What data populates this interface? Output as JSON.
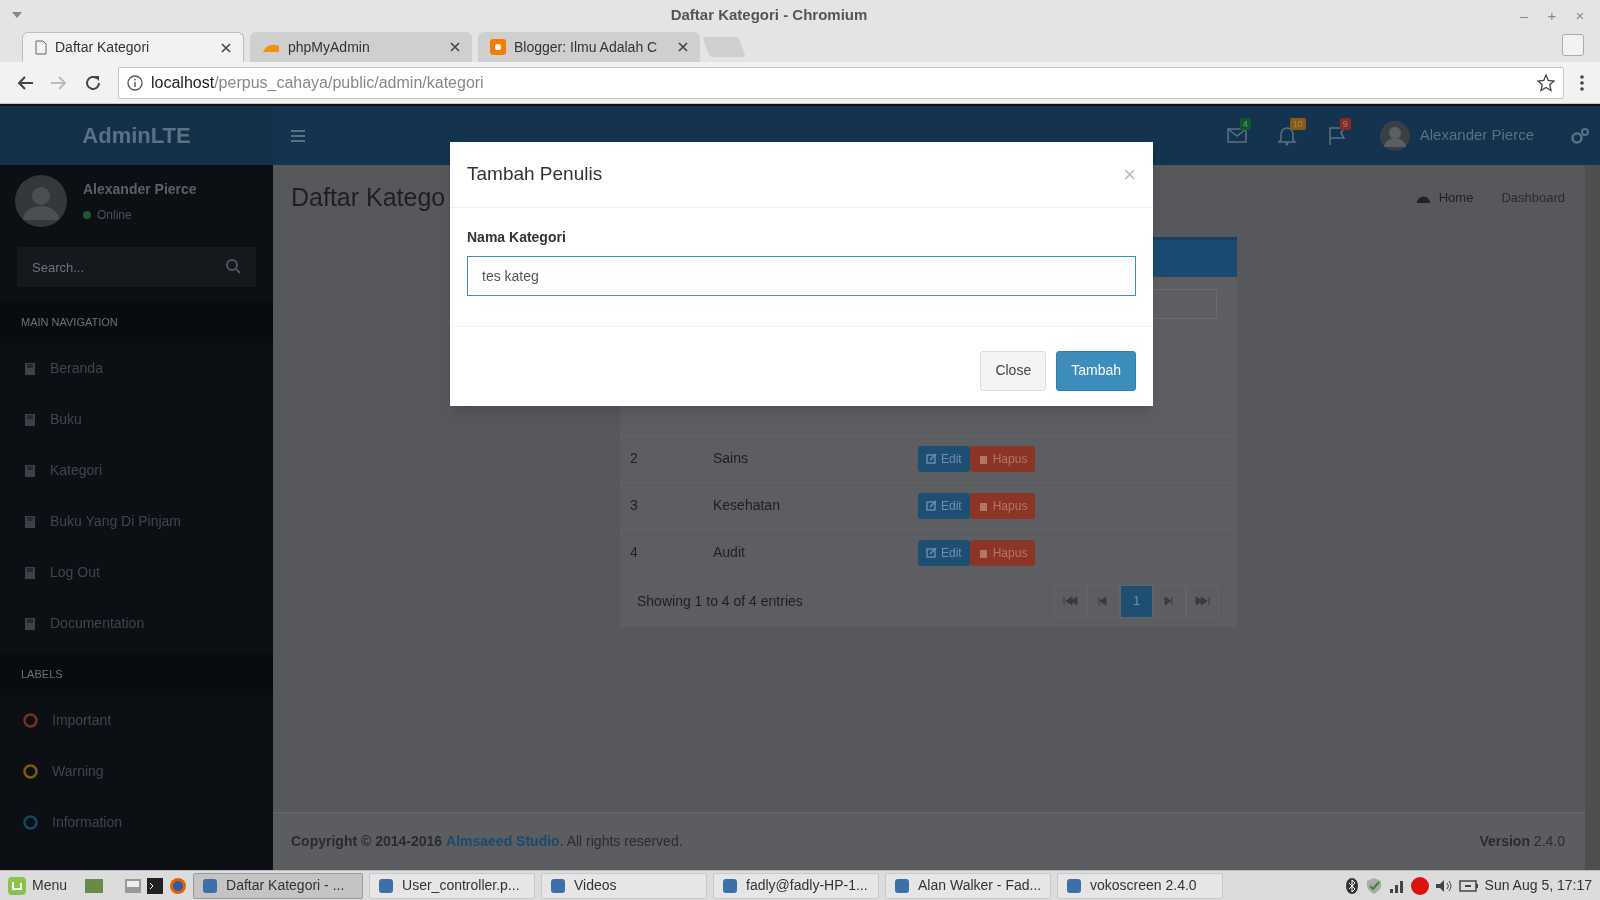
{
  "window": {
    "title": "Daftar Kategori - Chromium",
    "controls": [
      "–",
      "+",
      "×"
    ]
  },
  "browser_tabs": [
    {
      "label": "Daftar Kategori",
      "selected": true
    },
    {
      "label": "phpMyAdmin",
      "selected": false
    },
    {
      "label": "Blogger: Ilmu Adalah C",
      "selected": false
    }
  ],
  "address_bar": {
    "host": "localhost",
    "path": "/perpus_cahaya/public/admin/kategori"
  },
  "header": {
    "logo": "AdminLTE",
    "notifications": [
      {
        "kind": "mail",
        "count": "4",
        "color": "#0b5a2c"
      },
      {
        "kind": "bell",
        "count": "10",
        "color": "#8a5a10"
      },
      {
        "kind": "flag",
        "count": "9",
        "color": "#8a2a22"
      }
    ],
    "user": "Alexander Pierce"
  },
  "sidebar": {
    "user": "Alexander Pierce",
    "status": "Online",
    "search_placeholder": "Search...",
    "nav_header": "MAIN NAVIGATION",
    "items": [
      "Beranda",
      "Buku",
      "Kategori",
      "Buku Yang Di Pinjam",
      "Log Out",
      "Documentation"
    ],
    "labels_header": "LABELS",
    "labels": [
      {
        "label": "Important",
        "color": "#7a2e22"
      },
      {
        "label": "Warning",
        "color": "#7a5a10"
      },
      {
        "label": "Information",
        "color": "#0e4a66"
      }
    ]
  },
  "content": {
    "heading": "Daftar Katego",
    "breadcrumb": [
      "Home",
      "Dashboard"
    ],
    "rows": [
      {
        "no": "2",
        "name": "Sains",
        "actions": [
          "Edit",
          "Hapus"
        ]
      },
      {
        "no": "3",
        "name": "Kesehatan",
        "actions": [
          "Edit",
          "Hapus"
        ]
      },
      {
        "no": "4",
        "name": "Audit",
        "actions": [
          "Edit",
          "Hapus"
        ]
      }
    ],
    "info": "Showing 1 to 4 of 4 entries",
    "pages": [
      {
        "kind": "first",
        "selected": false
      },
      {
        "kind": "prev",
        "selected": false
      },
      {
        "kind": "page",
        "label": "1",
        "selected": true
      },
      {
        "kind": "next",
        "selected": false
      },
      {
        "kind": "last",
        "selected": false
      }
    ]
  },
  "footer": {
    "copyright": "**Copyright © 2014-2016**",
    "link": "Almsaeed Studio",
    "rest": ". All rights reserved.",
    "version": "**Version** 2.4.0"
  },
  "modal": {
    "title": "Tambah Penulis",
    "close": "×",
    "label": "Nama Kategori",
    "value": "tes kateg",
    "buttons": [
      {
        "kind": "default",
        "label": "Close"
      },
      {
        "kind": "primary",
        "label": "Tambah"
      }
    ]
  },
  "taskbar": {
    "menu": "Menu",
    "tasks": [
      {
        "label": "Daftar Kategori - ...",
        "selected": true
      },
      {
        "label": "User_controller.p...",
        "selected": false
      },
      {
        "label": "Videos",
        "selected": false
      },
      {
        "label": "fadly@fadly-HP-1...",
        "selected": false
      },
      {
        "label": "Alan Walker - Fad...",
        "selected": false
      },
      {
        "label": "vokoscreen 2.4.0",
        "selected": false
      }
    ],
    "clock": "Sun Aug 5, 17:17"
  }
}
